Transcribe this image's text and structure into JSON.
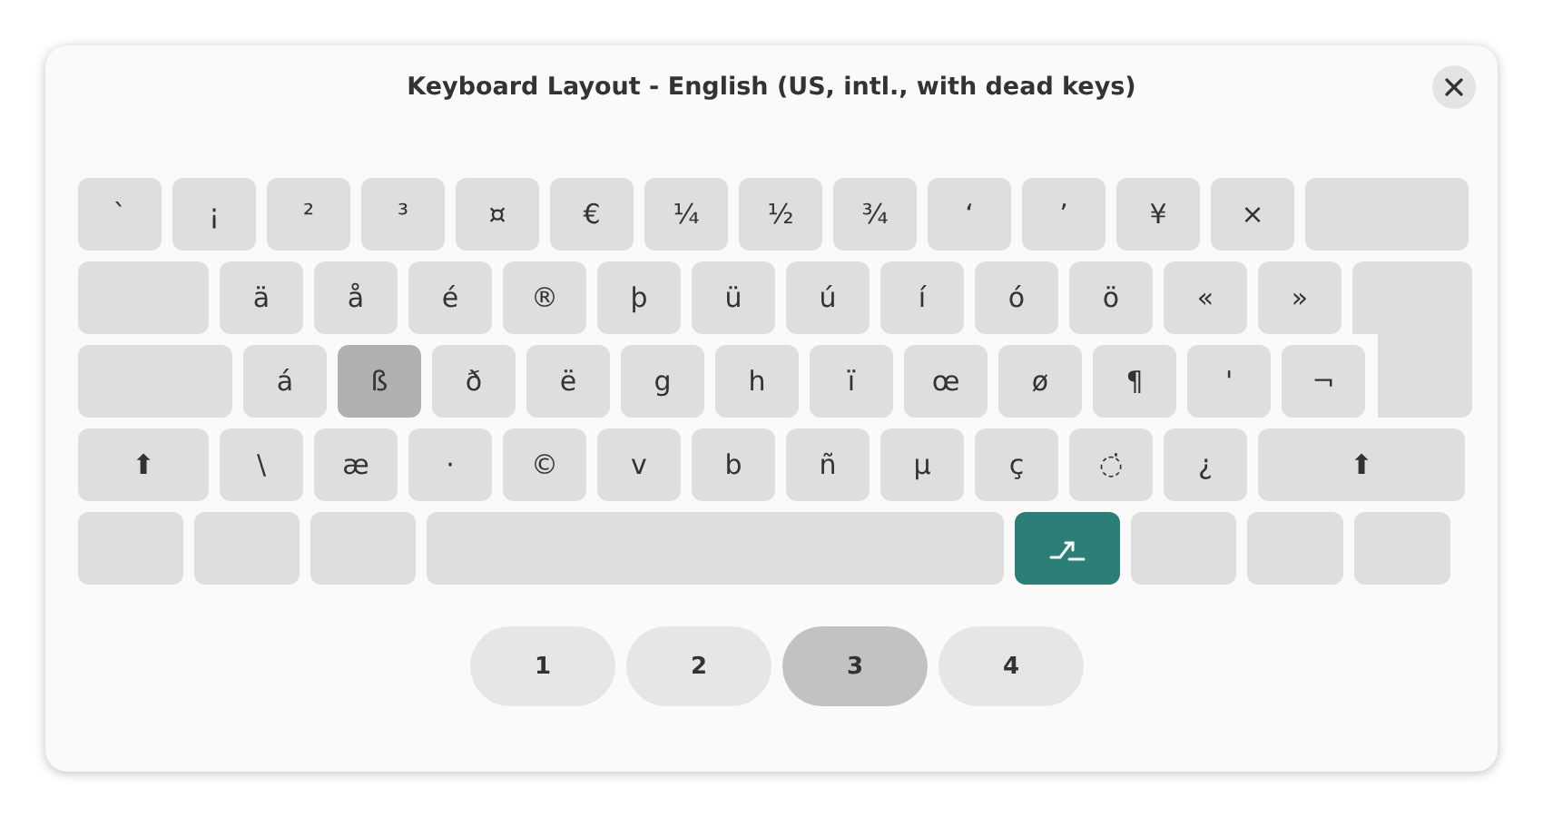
{
  "window": {
    "title": "Keyboard Layout - English (US, intl., with dead keys)"
  },
  "keyboard": {
    "rows": [
      [
        {
          "kind": "char",
          "label": "`",
          "pressed": false
        },
        {
          "kind": "char",
          "label": "¡",
          "pressed": false
        },
        {
          "kind": "char",
          "label": "²",
          "pressed": false
        },
        {
          "kind": "char",
          "label": "³",
          "pressed": false
        },
        {
          "kind": "char",
          "label": "¤",
          "pressed": false
        },
        {
          "kind": "char",
          "label": "€",
          "pressed": false
        },
        {
          "kind": "char",
          "label": "¼",
          "pressed": false
        },
        {
          "kind": "char",
          "label": "½",
          "pressed": false
        },
        {
          "kind": "char",
          "label": "¾",
          "pressed": false
        },
        {
          "kind": "char",
          "label": "‘",
          "pressed": false
        },
        {
          "kind": "char",
          "label": "’",
          "pressed": false
        },
        {
          "kind": "char",
          "label": "¥",
          "pressed": false
        },
        {
          "kind": "char",
          "label": "×",
          "pressed": false
        },
        {
          "kind": "backspace",
          "pressed": false
        }
      ],
      [
        {
          "kind": "tab",
          "pressed": false
        },
        {
          "kind": "char",
          "label": "ä",
          "pressed": false
        },
        {
          "kind": "char",
          "label": "å",
          "pressed": false
        },
        {
          "kind": "char",
          "label": "é",
          "pressed": false
        },
        {
          "kind": "char",
          "label": "®",
          "pressed": false
        },
        {
          "kind": "char",
          "label": "þ",
          "pressed": false
        },
        {
          "kind": "char",
          "label": "ü",
          "pressed": false
        },
        {
          "kind": "char",
          "label": "ú",
          "pressed": false
        },
        {
          "kind": "char",
          "label": "í",
          "pressed": false
        },
        {
          "kind": "char",
          "label": "ó",
          "pressed": false
        },
        {
          "kind": "char",
          "label": "ö",
          "pressed": false
        },
        {
          "kind": "char",
          "label": "«",
          "pressed": false
        },
        {
          "kind": "char",
          "label": "»",
          "pressed": false
        },
        {
          "kind": "enter",
          "pressed": false
        }
      ],
      [
        {
          "kind": "caps",
          "pressed": false
        },
        {
          "kind": "char",
          "label": "á",
          "pressed": false
        },
        {
          "kind": "char",
          "label": "ß",
          "pressed": true
        },
        {
          "kind": "char",
          "label": "ð",
          "pressed": false
        },
        {
          "kind": "char",
          "label": "ë",
          "pressed": false
        },
        {
          "kind": "char",
          "label": "g",
          "pressed": false
        },
        {
          "kind": "char",
          "label": "h",
          "pressed": false
        },
        {
          "kind": "char",
          "label": "ï",
          "pressed": false
        },
        {
          "kind": "char",
          "label": "œ",
          "pressed": false
        },
        {
          "kind": "char",
          "label": "ø",
          "pressed": false
        },
        {
          "kind": "char",
          "label": "¶",
          "pressed": false
        },
        {
          "kind": "char",
          "label": "'",
          "pressed": false
        },
        {
          "kind": "char",
          "label": "¬",
          "pressed": false
        }
      ],
      [
        {
          "kind": "shift-left",
          "label": "⬆",
          "pressed": false
        },
        {
          "kind": "char",
          "label": "\\",
          "pressed": false
        },
        {
          "kind": "char",
          "label": "æ",
          "pressed": false
        },
        {
          "kind": "char",
          "label": "·",
          "pressed": false
        },
        {
          "kind": "char",
          "label": "©",
          "pressed": false
        },
        {
          "kind": "char",
          "label": "v",
          "pressed": false
        },
        {
          "kind": "char",
          "label": "b",
          "pressed": false
        },
        {
          "kind": "char",
          "label": "ñ",
          "pressed": false
        },
        {
          "kind": "char",
          "label": "µ",
          "pressed": false
        },
        {
          "kind": "char",
          "label": "ç",
          "pressed": false
        },
        {
          "kind": "char",
          "label": "◌̇",
          "pressed": false
        },
        {
          "kind": "char",
          "label": "¿",
          "pressed": false
        },
        {
          "kind": "shift-right",
          "label": "⬆",
          "pressed": false
        }
      ],
      [
        {
          "kind": "modifier",
          "pressed": false
        },
        {
          "kind": "modifier",
          "pressed": false
        },
        {
          "kind": "modifier",
          "pressed": false
        },
        {
          "kind": "space",
          "pressed": false
        },
        {
          "kind": "level3",
          "pressed": true
        },
        {
          "kind": "modifier",
          "pressed": false
        },
        {
          "kind": "modifier-small",
          "pressed": false
        },
        {
          "kind": "modifier-small",
          "pressed": false
        }
      ]
    ]
  },
  "levels": [
    {
      "label": "1",
      "selected": false
    },
    {
      "label": "2",
      "selected": false
    },
    {
      "label": "3",
      "selected": true
    },
    {
      "label": "4",
      "selected": false
    }
  ]
}
